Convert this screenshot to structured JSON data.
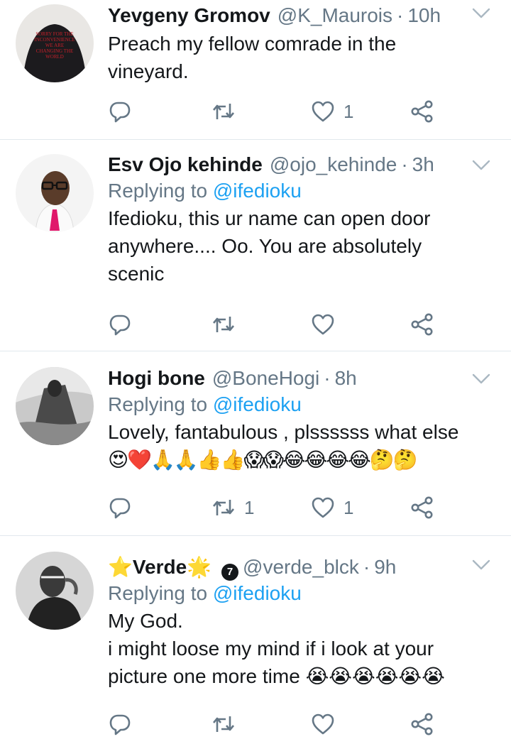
{
  "tweets": [
    {
      "name": "Yevgeny Gromov",
      "handle": "@K_Maurois",
      "dot": "·",
      "time": "10h",
      "replying_label": "",
      "replying_to": "",
      "text_lines": [
        "Preach my fellow comrade in the",
        "vineyard."
      ],
      "emoji_line": "",
      "reply_count": "",
      "retweet_count": "",
      "like_count": "1",
      "avatar_text_lines": [
        "SORRY FOR THE",
        "INCONVENIENCE",
        "WE ARE",
        "CHANGING THE",
        "WORLD"
      ]
    },
    {
      "name": "Esv Ojo kehinde",
      "handle": "@ojo_kehinde",
      "dot": "·",
      "time": "3h",
      "replying_label": "Replying to ",
      "replying_to": "@ifedioku",
      "text_lines": [
        "Ifedioku, this ur name can open door",
        "anywhere.... Oo. You are absolutely",
        "scenic"
      ],
      "emoji_line": "",
      "reply_count": "",
      "retweet_count": "",
      "like_count": ""
    },
    {
      "name": "Hogi bone",
      "handle": "@BoneHogi",
      "dot": "·",
      "time": "8h",
      "replying_label": "Replying to ",
      "replying_to": "@ifedioku",
      "text_lines": [
        "Lovely, fantabulous , plssssss what else"
      ],
      "emoji_line": "😍❤️🙏🙏👍👍😱😱😂😂😂😂🤔🤔",
      "reply_count": "",
      "retweet_count": "1",
      "like_count": "1"
    },
    {
      "name_prefix": "⭐",
      "name": "Verde",
      "name_suffix": "🌟",
      "badge": "7",
      "handle": "@verde_blck",
      "dot": "·",
      "time": "9h",
      "replying_label": "Replying to ",
      "replying_to": "@ifedioku",
      "text_lines": [
        "My God.",
        "i might loose my mind if i look at your",
        "picture one more time 😭😭😭😭😭😭"
      ],
      "emoji_line": "",
      "reply_count": "",
      "retweet_count": "",
      "like_count": ""
    }
  ],
  "icons": {
    "reply": "reply-icon",
    "retweet": "retweet-icon",
    "like": "heart-icon",
    "share": "share-icon",
    "menu": "chevron-down-icon"
  },
  "colors": {
    "name": "#14171a",
    "secondary": "#657786",
    "link": "#1da1f2",
    "divider": "#e1e8ed"
  }
}
